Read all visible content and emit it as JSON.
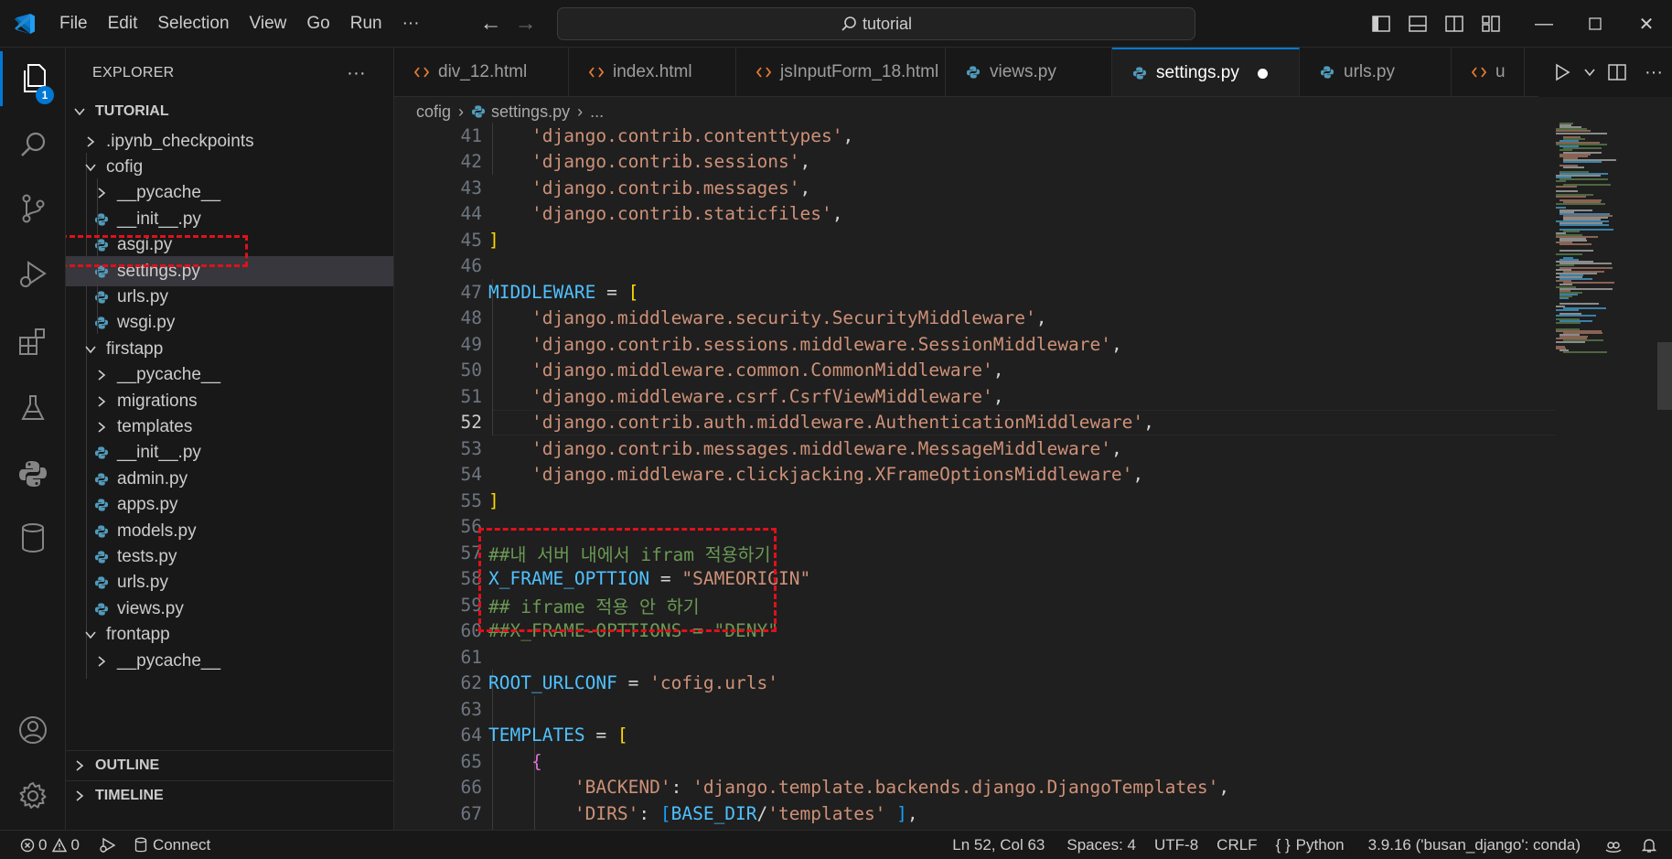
{
  "titlebar": {
    "menu": [
      "File",
      "Edit",
      "Selection",
      "View",
      "Go",
      "Run",
      "···"
    ],
    "search_text": "tutorial"
  },
  "activitybar": {
    "explorer_badge": "1"
  },
  "sidebar": {
    "header": "EXPLORER",
    "more": "···",
    "root": "TUTORIAL",
    "items": [
      {
        "label": ".ipynb_checkpoints",
        "kind": "folder"
      },
      {
        "label": "cofig",
        "kind": "folder-open"
      },
      {
        "label": "__pycache__",
        "kind": "folder"
      },
      {
        "label": "__init__.py",
        "kind": "python"
      },
      {
        "label": "asgi.py",
        "kind": "python"
      },
      {
        "label": "settings.py",
        "kind": "python"
      },
      {
        "label": "urls.py",
        "kind": "python"
      },
      {
        "label": "wsgi.py",
        "kind": "python"
      },
      {
        "label": "firstapp",
        "kind": "folder-open"
      },
      {
        "label": "__pycache__",
        "kind": "folder"
      },
      {
        "label": "migrations",
        "kind": "folder"
      },
      {
        "label": "templates",
        "kind": "folder"
      },
      {
        "label": "__init__.py",
        "kind": "python"
      },
      {
        "label": "admin.py",
        "kind": "python"
      },
      {
        "label": "apps.py",
        "kind": "python"
      },
      {
        "label": "models.py",
        "kind": "python"
      },
      {
        "label": "tests.py",
        "kind": "python"
      },
      {
        "label": "urls.py",
        "kind": "python"
      },
      {
        "label": "views.py",
        "kind": "python"
      },
      {
        "label": "frontapp",
        "kind": "folder-open"
      },
      {
        "label": "__pycache__",
        "kind": "folder"
      }
    ],
    "outline": "OUTLINE",
    "timeline": "TIMELINE"
  },
  "tabs": [
    {
      "label": "div_12.html",
      "kind": "html"
    },
    {
      "label": "index.html",
      "kind": "html"
    },
    {
      "label": "jsInputForm_18.html",
      "kind": "html"
    },
    {
      "label": "views.py",
      "kind": "python"
    },
    {
      "label": "settings.py",
      "kind": "python",
      "active": true
    },
    {
      "label": "urls.py",
      "kind": "python"
    },
    {
      "label": "u",
      "kind": "html"
    }
  ],
  "breadcrumb": {
    "folder": "cofig",
    "file": "settings.py",
    "rest": "..."
  },
  "code": {
    "numbers": [
      "41",
      "42",
      "43",
      "44",
      "45",
      "46",
      "47",
      "48",
      "49",
      "50",
      "51",
      "52",
      "53",
      "54",
      "55",
      "56",
      "57",
      "58",
      "59",
      "60",
      "61",
      "62",
      "63",
      "64",
      "65",
      "66",
      "67"
    ],
    "l41": "'django.contrib.contenttypes'",
    "l42": "'django.contrib.sessions'",
    "l43": "'django.contrib.messages'",
    "l44": "'django.contrib.staticfiles'",
    "l47_var": "MIDDLEWARE",
    "l48": "'django.middleware.security.SecurityMiddleware'",
    "l49": "'django.contrib.sessions.middleware.SessionMiddleware'",
    "l50": "'django.middleware.common.CommonMiddleware'",
    "l51": "'django.middleware.csrf.CsrfViewMiddleware'",
    "l52": "'django.contrib.auth.middleware.AuthenticationMiddleware'",
    "l53": "'django.contrib.messages.middleware.MessageMiddleware'",
    "l54": "'django.middleware.clickjacking.XFrameOptionsMiddleware'",
    "l57": "##내 서버 내에서 ifram 적용하기",
    "l58_var": "X_FRAME_OPTTION",
    "l58_val": "\"SAMEORIGIN\"",
    "l59": "## iframe 적용 안 하기",
    "l60": "##X_FRAME-OPTTIONS = \"DENY\"",
    "l62_var": "ROOT_URLCONF",
    "l62_val": "'cofig.urls'",
    "l64_var": "TEMPLATES",
    "l66_key": "'BACKEND'",
    "l66_val": "'django.template.backends.django.DjangoTemplates'",
    "l67_key": "'DIRS'",
    "l67_var": "BASE_DIR",
    "l67_val": "'templates'"
  },
  "statusbar": {
    "errors": "0",
    "warnings": "0",
    "connect": "Connect",
    "position": "Ln 52, Col 63",
    "spaces": "Spaces: 4",
    "encoding": "UTF-8",
    "eol": "CRLF",
    "language": "Python",
    "interpreter": "3.9.16 ('busan_django': conda)"
  },
  "colors": {
    "accent": "#0078d4",
    "annotation": "#e0101a",
    "string": "#ce9178",
    "variable": "#4fc1ff",
    "comment": "#6a9955"
  }
}
